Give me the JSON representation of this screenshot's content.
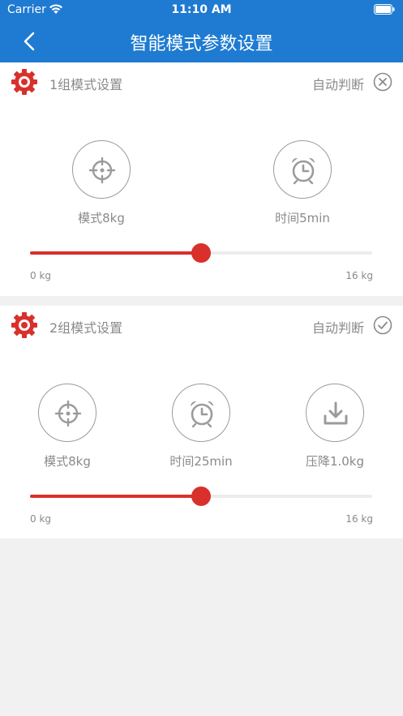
{
  "status_bar": {
    "carrier": "Carrier",
    "time": "11:10 AM"
  },
  "nav": {
    "title": "智能模式参数设置",
    "back_icon": "chevron-left-icon"
  },
  "colors": {
    "header": "#1e7bd1",
    "accent_red": "#d9302c",
    "grey": "#8a8a8a"
  },
  "groups": [
    {
      "title": "1组模式设置",
      "auto_label": "自动判断",
      "status_icon": "close-circle-icon",
      "controls": [
        {
          "icon": "crosshair-icon",
          "label": "模式8kg"
        },
        {
          "icon": "alarm-clock-icon",
          "label": "时间5min"
        }
      ],
      "slider": {
        "value_fraction": 0.5,
        "min_label": "0 kg",
        "max_label": "16 kg"
      }
    },
    {
      "title": "2组模式设置",
      "auto_label": "自动判断",
      "status_icon": "check-circle-icon",
      "controls": [
        {
          "icon": "crosshair-icon",
          "label": "模式8kg"
        },
        {
          "icon": "alarm-clock-icon",
          "label": "时间25min"
        },
        {
          "icon": "download-icon",
          "label": "压降1.0kg"
        }
      ],
      "slider": {
        "value_fraction": 0.5,
        "min_label": "0 kg",
        "max_label": "16 kg"
      }
    }
  ]
}
